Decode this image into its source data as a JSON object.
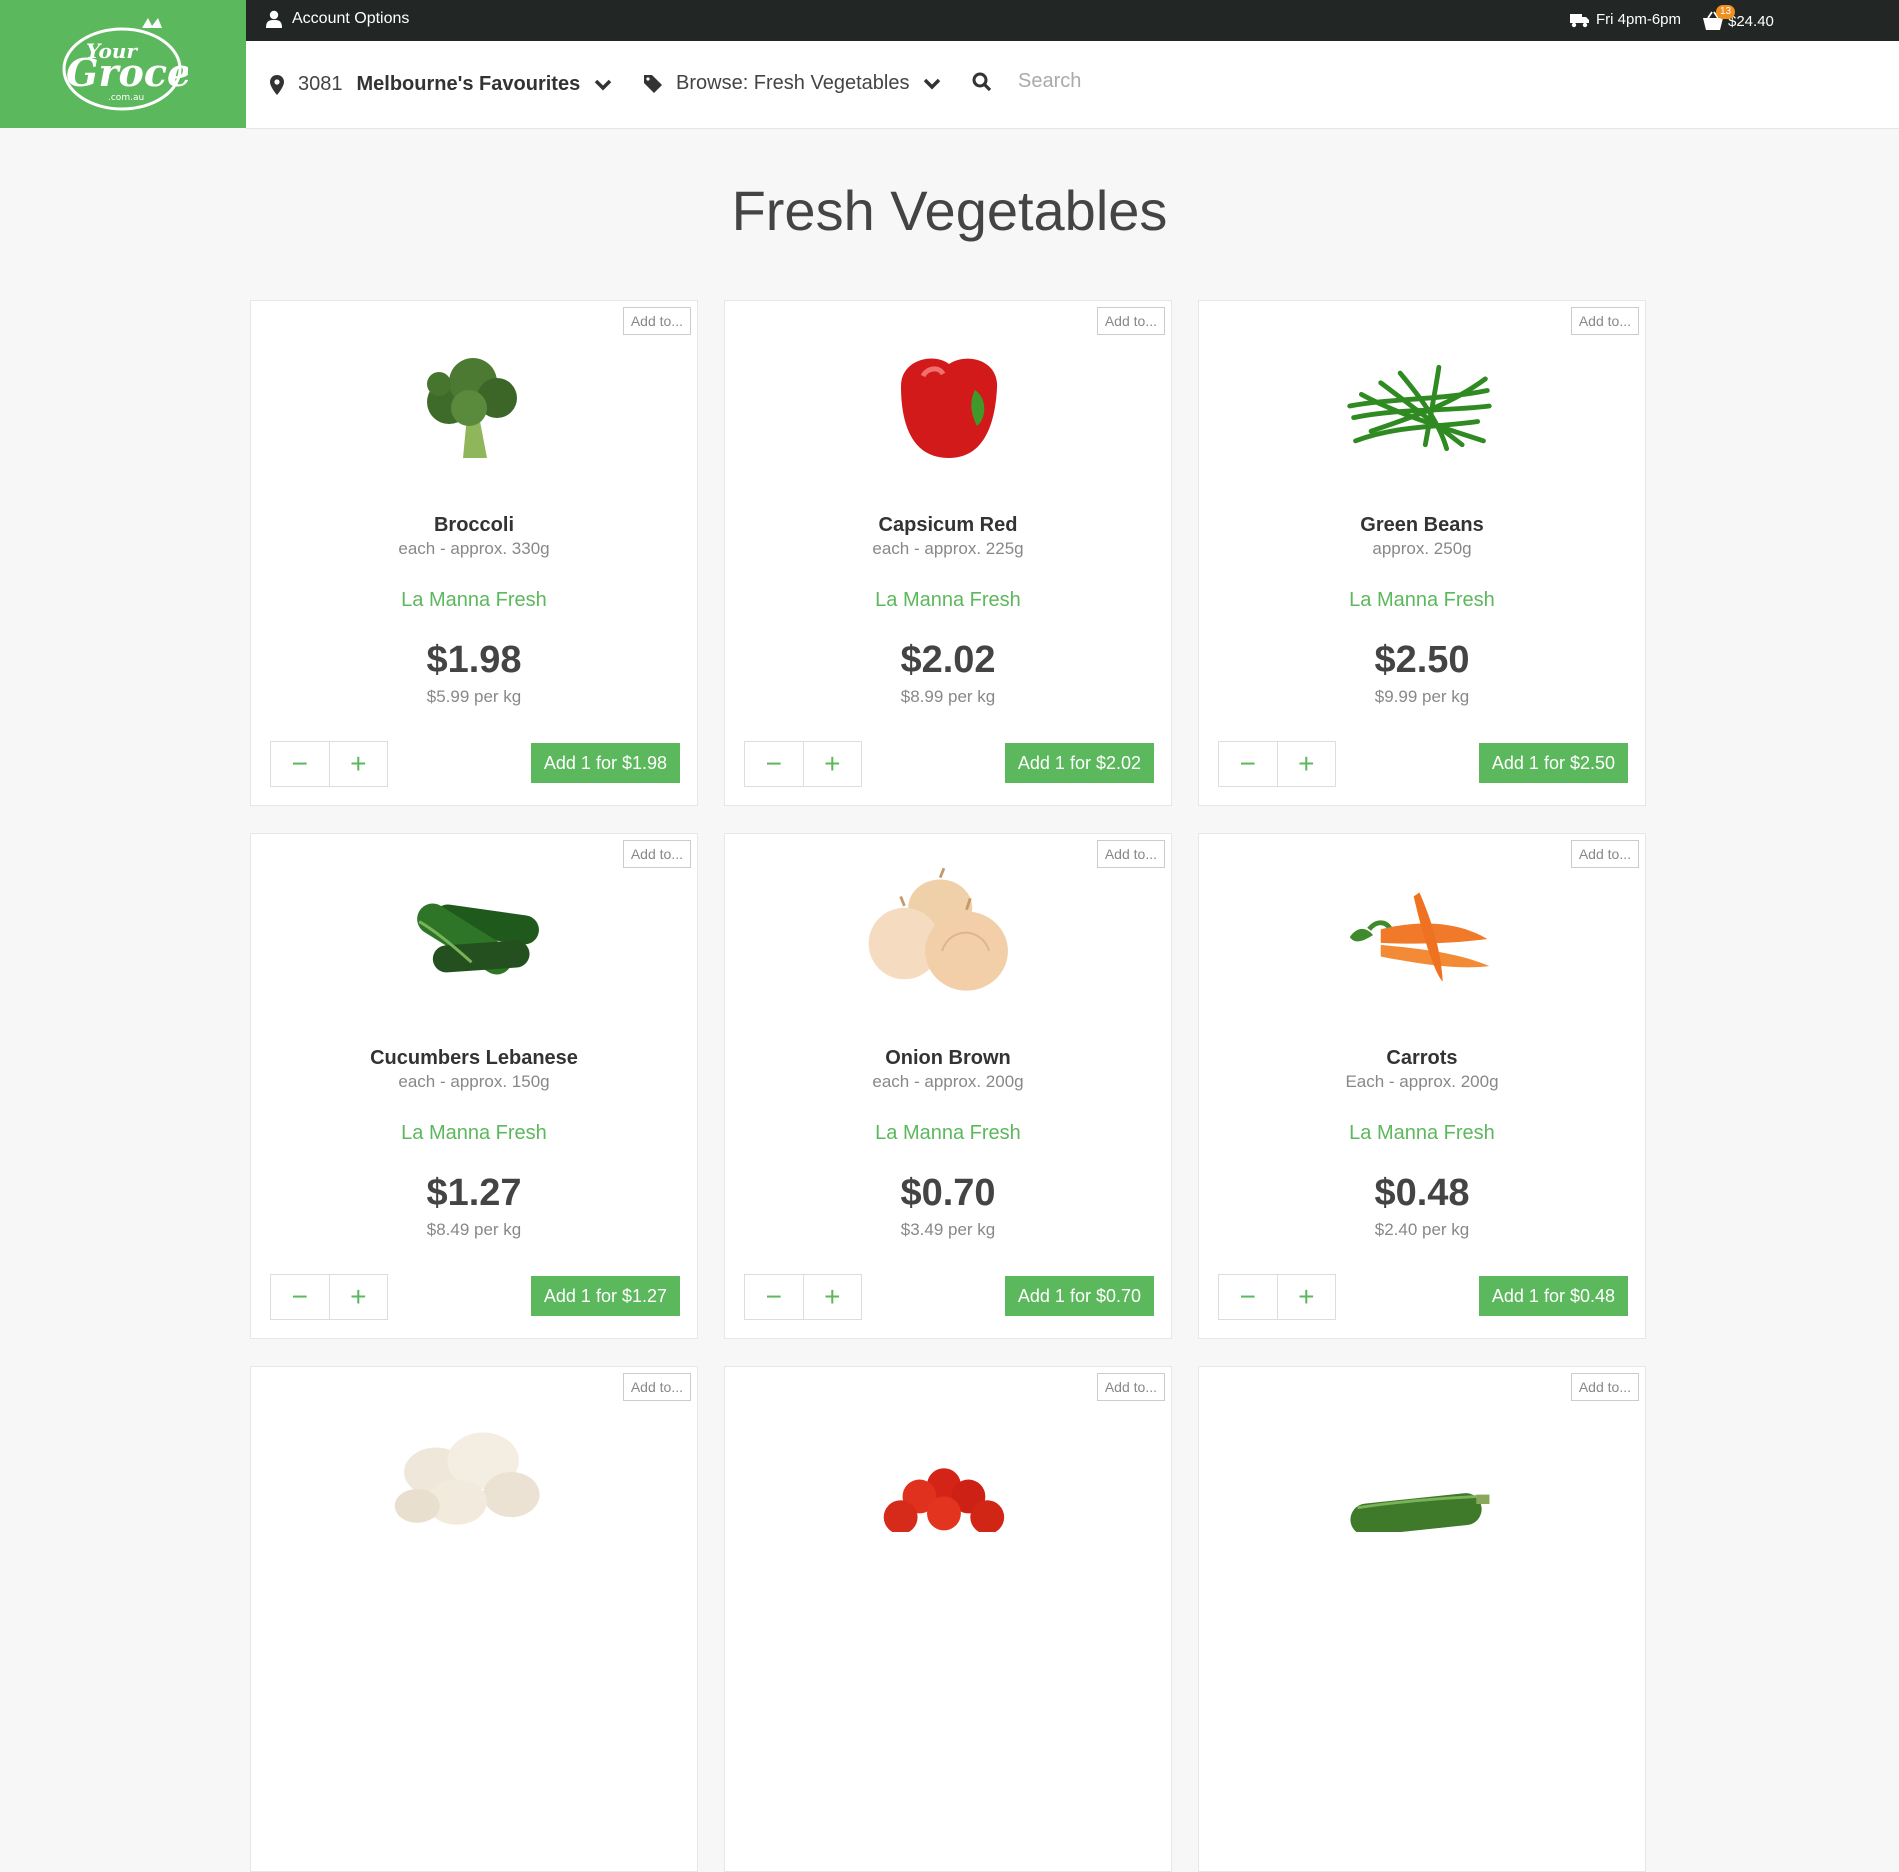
{
  "topbar": {
    "account_label": "Account Options",
    "delivery_label": "Fri 4pm-6pm",
    "cart_count": "13",
    "cart_total": "$24.40"
  },
  "logo": {
    "line1": "Your",
    "line2": "Grocer",
    "line3": ".com.au"
  },
  "nav": {
    "postcode": "3081",
    "store": "Melbourne's Favourites",
    "browse": "Browse: Fresh Vegetables",
    "search_placeholder": "Search"
  },
  "page_title": "Fresh Vegetables",
  "products": [
    {
      "add_to": "Add to...",
      "name": "Broccoli",
      "size": "each - approx. 330g",
      "brand": "La Manna Fresh",
      "price": "$1.98",
      "unit": "$5.99 per kg",
      "add_label": "Add 1 for $1.98",
      "icon": "broccoli-image"
    },
    {
      "add_to": "Add to...",
      "name": "Capsicum Red",
      "size": "each - approx. 225g",
      "brand": "La Manna Fresh",
      "price": "$2.02",
      "unit": "$8.99 per kg",
      "add_label": "Add 1 for $2.02",
      "icon": "capsicum-image"
    },
    {
      "add_to": "Add to...",
      "name": "Green Beans",
      "size": "approx. 250g",
      "brand": "La Manna Fresh",
      "price": "$2.50",
      "unit": "$9.99 per kg",
      "add_label": "Add 1 for $2.50",
      "icon": "green-beans-image"
    },
    {
      "add_to": "Add to...",
      "name": "Cucumbers Lebanese",
      "size": "each - approx. 150g",
      "brand": "La Manna Fresh",
      "price": "$1.27",
      "unit": "$8.49 per kg",
      "add_label": "Add 1 for $1.27",
      "icon": "cucumber-image"
    },
    {
      "add_to": "Add to...",
      "name": "Onion Brown",
      "size": "each - approx. 200g",
      "brand": "La Manna Fresh",
      "price": "$0.70",
      "unit": "$3.49 per kg",
      "add_label": "Add 1 for $0.70",
      "icon": "onion-image"
    },
    {
      "add_to": "Add to...",
      "name": "Carrots",
      "size": "Each - approx. 200g",
      "brand": "La Manna Fresh",
      "price": "$0.48",
      "unit": "$2.40 per kg",
      "add_label": "Add 1 for $0.48",
      "icon": "carrot-image"
    },
    {
      "add_to": "Add to...",
      "icon": "mushroom-image"
    },
    {
      "add_to": "Add to...",
      "icon": "cherry-tomato-image"
    },
    {
      "add_to": "Add to...",
      "icon": "zucchini-image"
    }
  ]
}
